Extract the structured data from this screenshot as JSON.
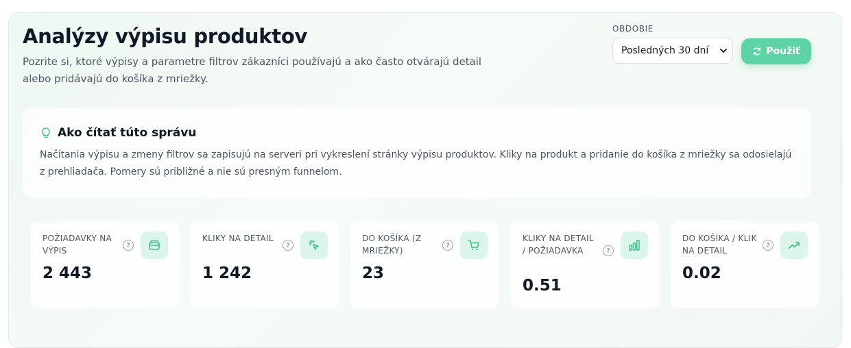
{
  "header": {
    "title": "Analýzy výpisu produktov",
    "subtitle": "Pozrite si, ktoré výpisy a parametre filtrov zákazníci používajú a ako často otvárajú detail alebo pridávajú do košíka z mriežky."
  },
  "period": {
    "label": "OBDOBIE",
    "selected": "Posledných 30 dní"
  },
  "apply_button": {
    "label": "Použiť",
    "icon": "refresh-icon"
  },
  "info": {
    "icon": "lightbulb-icon",
    "title": "Ako čítať túto správu",
    "text": "Načítania výpisu a zmeny filtrov sa zapisujú na serveri pri vykreslení stránky výpisu produktov. Kliky na produkt a pridanie do košíka z mriežky sa odosielajú z prehliadača. Pomery sú približné a nie sú presným funnelom."
  },
  "stats": [
    {
      "label": "Požiadavky na výpis",
      "value": "2 443",
      "icon": "wallet-icon"
    },
    {
      "label": "Kliky na detail",
      "value": "1 242",
      "icon": "pointer-click-icon"
    },
    {
      "label": "Do košíka (z mriežky)",
      "value": "23",
      "icon": "cart-icon"
    },
    {
      "label": "Kliky na detail / požiadavka",
      "value": "0.51",
      "icon": "bar-chart-icon"
    },
    {
      "label": "Do košíka / klik na detail",
      "value": "0.02",
      "icon": "trending-up-icon"
    }
  ],
  "help_glyph": "?",
  "colors": {
    "accent": "#5ed4a5",
    "icon_bg": "#dcf5ea",
    "icon_stroke": "#3fbf8a"
  }
}
